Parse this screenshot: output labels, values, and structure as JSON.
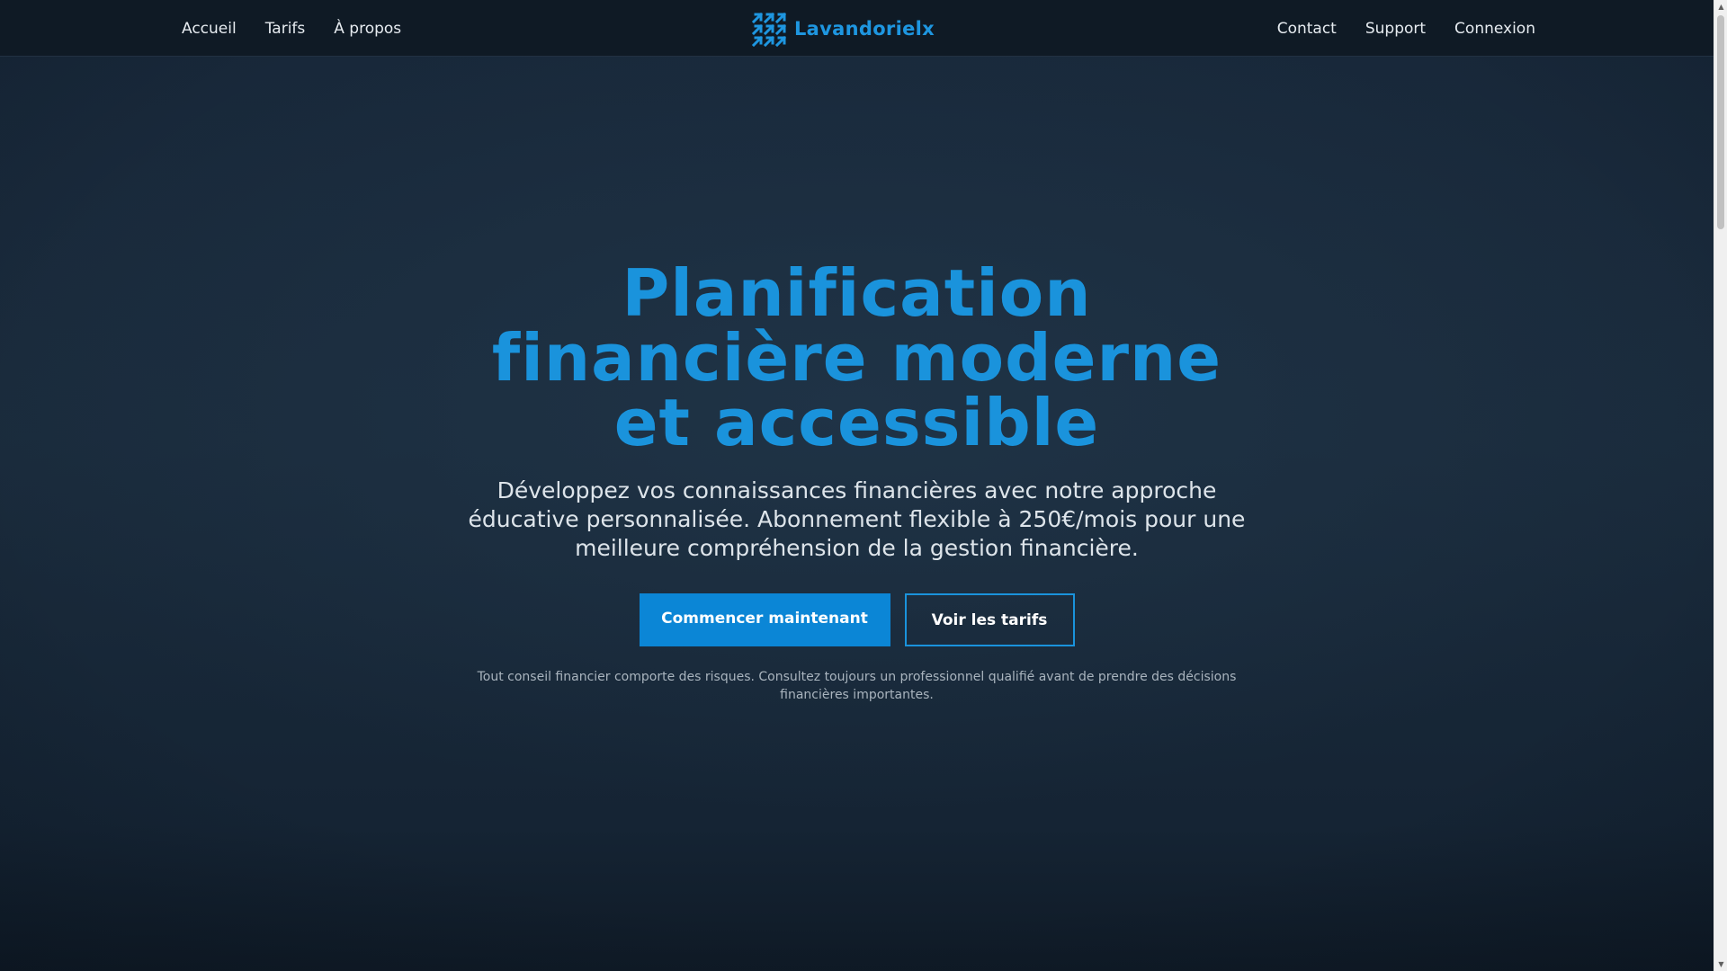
{
  "nav": {
    "left": [
      {
        "label": "Accueil"
      },
      {
        "label": "Tarifs"
      },
      {
        "label": "À propos"
      }
    ],
    "right": [
      {
        "label": "Contact"
      },
      {
        "label": "Support"
      },
      {
        "label": "Connexion"
      }
    ],
    "brand": {
      "name": "Lavandorielx",
      "icon": "arrows-logo-icon"
    }
  },
  "hero": {
    "title": "Planification financière moderne et accessible",
    "subtitle": "Développez vos connaissances financières avec notre approche éducative personnalisée. Abonnement flexible à 250€/mois pour une meilleure compréhension de la gestion financière.",
    "primary_cta": "Commencer maintenant",
    "secondary_cta": "Voir les tarifs",
    "disclaimer": "Tout conseil financier comporte des risques. Consultez toujours un professionnel qualifié avant de prendre des décisions financières importantes."
  },
  "scrollbar": {
    "up_icon": "▲",
    "down_icon": "▼"
  },
  "colors": {
    "accent": "#1a93dc",
    "button": "#0b86d6",
    "nav_bg": "#0f1a25",
    "hero_bg": "#1a2b3c"
  }
}
